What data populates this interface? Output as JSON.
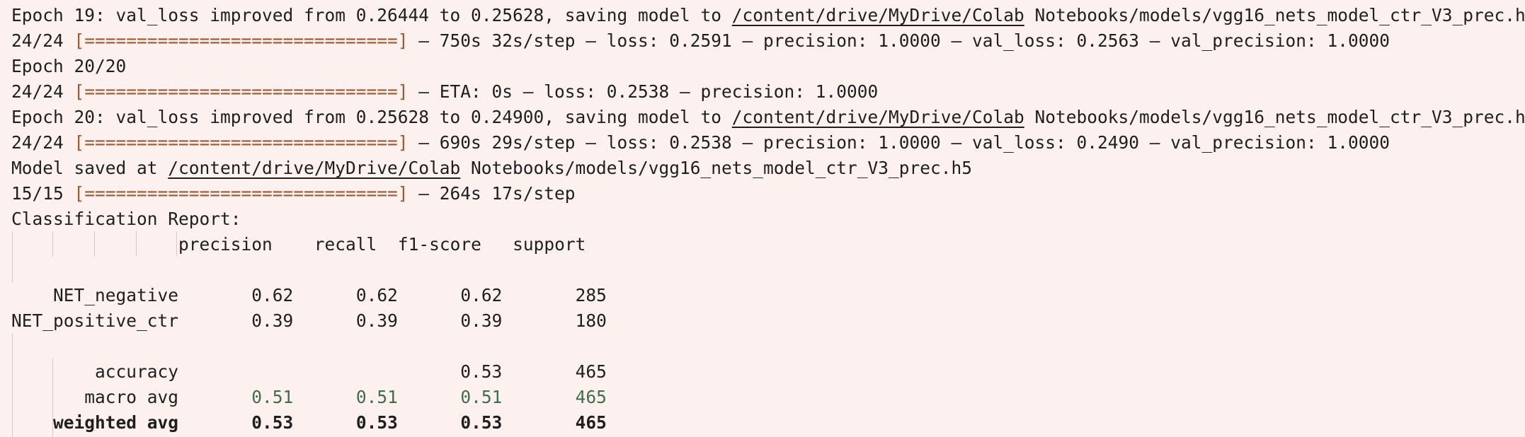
{
  "training_log": [
    {
      "pre": "Epoch 19: val_loss improved from 0.26444 to 0.25628, saving model to ",
      "path": "/content/drive/MyDrive/Colab",
      "post": " Notebooks/models/vgg16_nets_model_ctr_V3_prec.h5"
    },
    {
      "count": "24/24 ",
      "bar": "[==============================]",
      "metrics": " – 750s 32s/step – loss: 0.2591 – precision: 1.0000 – val_loss: 0.2563 – val_precision: 1.0000"
    },
    {
      "text": "Epoch 20/20"
    },
    {
      "count": "24/24 ",
      "bar": "[==============================]",
      "metrics": " – ETA: 0s – loss: 0.2538 – precision: 1.0000"
    },
    {
      "pre": "Epoch 20: val_loss improved from 0.25628 to 0.24900, saving model to ",
      "path": "/content/drive/MyDrive/Colab",
      "post": " Notebooks/models/vgg16_nets_model_ctr_V3_prec.h5"
    },
    {
      "count": "24/24 ",
      "bar": "[==============================]",
      "metrics": " – 690s 29s/step – loss: 0.2538 – precision: 1.0000 – val_loss: 0.2490 – val_precision: 1.0000"
    },
    {
      "pre": "Model saved at ",
      "path": "/content/drive/MyDrive/Colab",
      "post": " Notebooks/models/vgg16_nets_model_ctr_V3_prec.h5"
    },
    {
      "count": "15/15 ",
      "bar": "[==============================]",
      "metrics": " – 264s 17s/step"
    }
  ],
  "report": {
    "title": "Classification Report:",
    "headers": [
      "precision",
      "recall",
      "f1-score",
      "support"
    ],
    "rows": [
      {
        "label": "NET_negative",
        "values": [
          "0.62",
          "0.62",
          "0.62",
          "285"
        ]
      },
      {
        "label": "NET_positive_ctr",
        "values": [
          "0.39",
          "0.39",
          "0.39",
          "180"
        ]
      }
    ],
    "summary": [
      {
        "label": "accuracy",
        "values": [
          "",
          "",
          "0.53",
          "465"
        ]
      },
      {
        "label": "macro avg",
        "values": [
          "0.51",
          "0.51",
          "0.51",
          "465"
        ]
      },
      {
        "label": "weighted avg",
        "values": [
          "0.53",
          "0.53",
          "0.53",
          "465"
        ]
      }
    ]
  },
  "colors": {
    "background": "#fcf1ee",
    "text": "#1f1f1f",
    "progress_bar": "#9a5a2e",
    "macro_avg": "#3f6e4d",
    "indent_guide": "#dcc9c2"
  }
}
